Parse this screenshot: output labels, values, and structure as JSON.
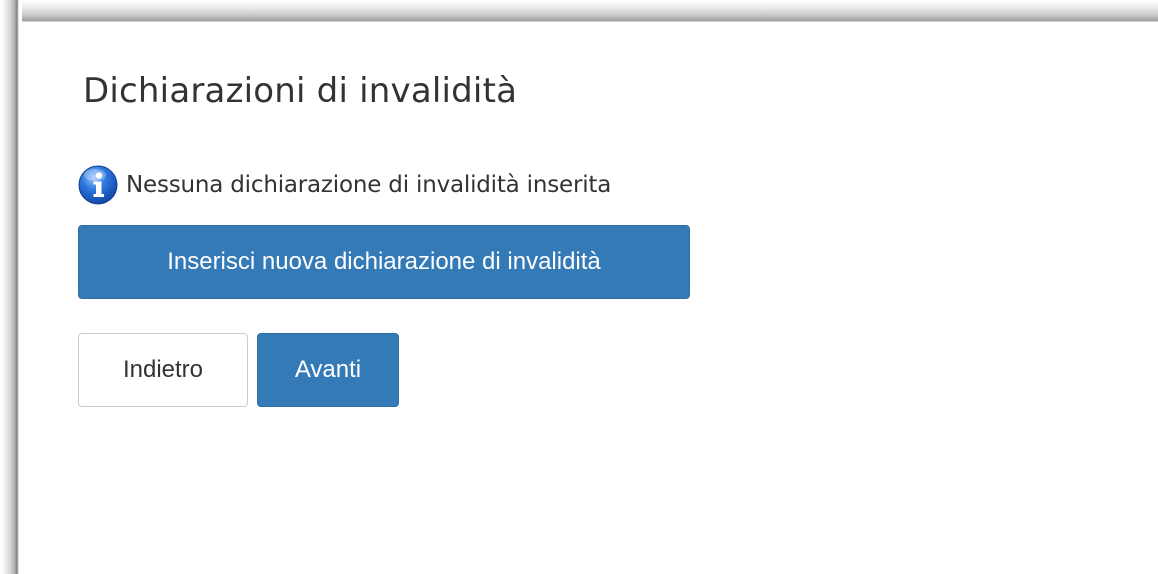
{
  "page": {
    "title": "Dichiarazioni di invalidità"
  },
  "notice": {
    "icon": "info-icon",
    "text": "Nessuna dichiarazione di invalidità inserita"
  },
  "actions": {
    "insert_label": "Inserisci nuova dichiarazione di invalidità",
    "back_label": "Indietro",
    "next_label": "Avanti"
  },
  "colors": {
    "primary_button": "#337ab7",
    "primary_button_border": "#2e6da4",
    "default_button_border": "#cccccc",
    "text": "#333333",
    "info_icon": "#1f5fc4"
  }
}
